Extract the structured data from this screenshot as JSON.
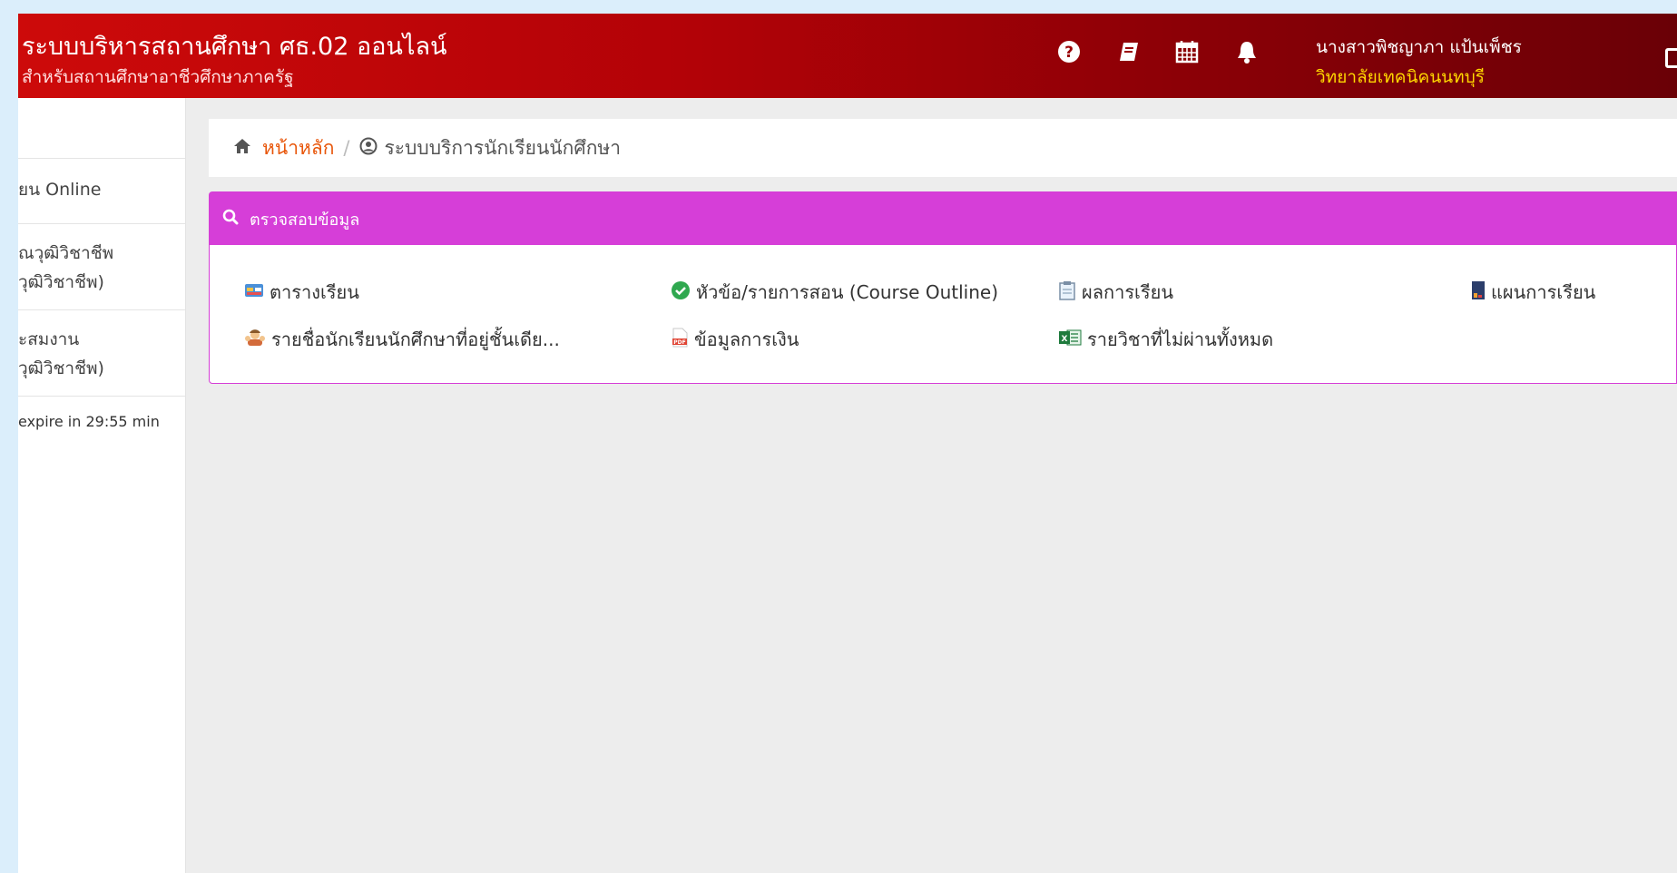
{
  "header": {
    "title": "ระบบบริหารสถานศึกษา ศธ.02 ออนไลน์",
    "subtitle": "สำหรับสถานศึกษาอาชีวศึกษาภาครัฐ",
    "icons": [
      "help-icon",
      "book-icon",
      "calendar-icon",
      "bell-icon",
      "logout-icon"
    ],
    "user_name": "นางสาวพิชญาภา แป้นเพ็ชร",
    "user_org": "วิทยาลัยเทคนิคนนทบุรี"
  },
  "sidebar": {
    "items": [
      {
        "line1": "ยน Online",
        "line2": ""
      },
      {
        "line1": "ณวุฒิวิชาชีพ",
        "line2": "วุฒิวิชาชีพ)"
      },
      {
        "line1": "ะสมงาน",
        "line2": "วุฒิวิชาชีพ)"
      }
    ],
    "session": "expire in 29:55 min"
  },
  "breadcrumb": {
    "home": "หน้าหลัก",
    "separator": "/",
    "current": "ระบบบริการนักเรียนนักศึกษา"
  },
  "panel": {
    "title": "ตรวจสอบข้อมูล",
    "links": [
      {
        "label": "ตารางเรียน",
        "icon": "timetable-icon"
      },
      {
        "label": "หัวข้อ/รายการสอน (Course Outline)",
        "icon": "check-circle-icon"
      },
      {
        "label": "ผลการเรียน",
        "icon": "clipboard-icon"
      },
      {
        "label": "แผนการเรียน",
        "icon": "plan-book-icon"
      },
      {
        "label": "รายชื่อนักเรียนนักศึกษาที่อยู่ชั้นเดีย...",
        "icon": "students-icon"
      },
      {
        "label": "ข้อมูลการเงิน",
        "icon": "pdf-icon"
      },
      {
        "label": "รายวิชาที่ไม่ผ่านทั้งหมด",
        "icon": "excel-icon"
      }
    ]
  },
  "colors": {
    "header_start": "#cd0a0a",
    "header_end": "#6a0006",
    "accent_orange": "#e8560a",
    "panel_purple": "#d63ed8",
    "user_org_gold": "#ffd700"
  }
}
